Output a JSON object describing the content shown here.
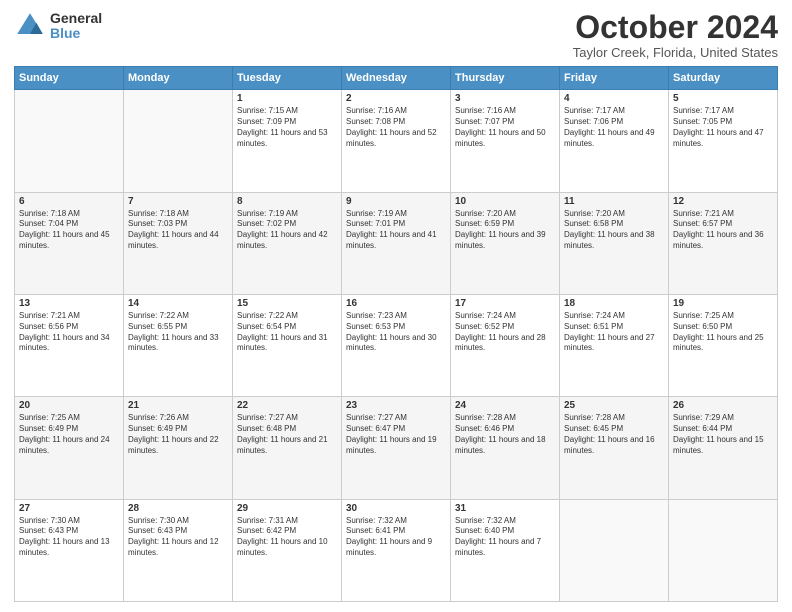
{
  "logo": {
    "general": "General",
    "blue": "Blue"
  },
  "header": {
    "title": "October 2024",
    "location": "Taylor Creek, Florida, United States"
  },
  "weekdays": [
    "Sunday",
    "Monday",
    "Tuesday",
    "Wednesday",
    "Thursday",
    "Friday",
    "Saturday"
  ],
  "weeks": [
    [
      {
        "day": "",
        "sunrise": "",
        "sunset": "",
        "daylight": ""
      },
      {
        "day": "",
        "sunrise": "",
        "sunset": "",
        "daylight": ""
      },
      {
        "day": "1",
        "sunrise": "Sunrise: 7:15 AM",
        "sunset": "Sunset: 7:09 PM",
        "daylight": "Daylight: 11 hours and 53 minutes."
      },
      {
        "day": "2",
        "sunrise": "Sunrise: 7:16 AM",
        "sunset": "Sunset: 7:08 PM",
        "daylight": "Daylight: 11 hours and 52 minutes."
      },
      {
        "day": "3",
        "sunrise": "Sunrise: 7:16 AM",
        "sunset": "Sunset: 7:07 PM",
        "daylight": "Daylight: 11 hours and 50 minutes."
      },
      {
        "day": "4",
        "sunrise": "Sunrise: 7:17 AM",
        "sunset": "Sunset: 7:06 PM",
        "daylight": "Daylight: 11 hours and 49 minutes."
      },
      {
        "day": "5",
        "sunrise": "Sunrise: 7:17 AM",
        "sunset": "Sunset: 7:05 PM",
        "daylight": "Daylight: 11 hours and 47 minutes."
      }
    ],
    [
      {
        "day": "6",
        "sunrise": "Sunrise: 7:18 AM",
        "sunset": "Sunset: 7:04 PM",
        "daylight": "Daylight: 11 hours and 45 minutes."
      },
      {
        "day": "7",
        "sunrise": "Sunrise: 7:18 AM",
        "sunset": "Sunset: 7:03 PM",
        "daylight": "Daylight: 11 hours and 44 minutes."
      },
      {
        "day": "8",
        "sunrise": "Sunrise: 7:19 AM",
        "sunset": "Sunset: 7:02 PM",
        "daylight": "Daylight: 11 hours and 42 minutes."
      },
      {
        "day": "9",
        "sunrise": "Sunrise: 7:19 AM",
        "sunset": "Sunset: 7:01 PM",
        "daylight": "Daylight: 11 hours and 41 minutes."
      },
      {
        "day": "10",
        "sunrise": "Sunrise: 7:20 AM",
        "sunset": "Sunset: 6:59 PM",
        "daylight": "Daylight: 11 hours and 39 minutes."
      },
      {
        "day": "11",
        "sunrise": "Sunrise: 7:20 AM",
        "sunset": "Sunset: 6:58 PM",
        "daylight": "Daylight: 11 hours and 38 minutes."
      },
      {
        "day": "12",
        "sunrise": "Sunrise: 7:21 AM",
        "sunset": "Sunset: 6:57 PM",
        "daylight": "Daylight: 11 hours and 36 minutes."
      }
    ],
    [
      {
        "day": "13",
        "sunrise": "Sunrise: 7:21 AM",
        "sunset": "Sunset: 6:56 PM",
        "daylight": "Daylight: 11 hours and 34 minutes."
      },
      {
        "day": "14",
        "sunrise": "Sunrise: 7:22 AM",
        "sunset": "Sunset: 6:55 PM",
        "daylight": "Daylight: 11 hours and 33 minutes."
      },
      {
        "day": "15",
        "sunrise": "Sunrise: 7:22 AM",
        "sunset": "Sunset: 6:54 PM",
        "daylight": "Daylight: 11 hours and 31 minutes."
      },
      {
        "day": "16",
        "sunrise": "Sunrise: 7:23 AM",
        "sunset": "Sunset: 6:53 PM",
        "daylight": "Daylight: 11 hours and 30 minutes."
      },
      {
        "day": "17",
        "sunrise": "Sunrise: 7:24 AM",
        "sunset": "Sunset: 6:52 PM",
        "daylight": "Daylight: 11 hours and 28 minutes."
      },
      {
        "day": "18",
        "sunrise": "Sunrise: 7:24 AM",
        "sunset": "Sunset: 6:51 PM",
        "daylight": "Daylight: 11 hours and 27 minutes."
      },
      {
        "day": "19",
        "sunrise": "Sunrise: 7:25 AM",
        "sunset": "Sunset: 6:50 PM",
        "daylight": "Daylight: 11 hours and 25 minutes."
      }
    ],
    [
      {
        "day": "20",
        "sunrise": "Sunrise: 7:25 AM",
        "sunset": "Sunset: 6:49 PM",
        "daylight": "Daylight: 11 hours and 24 minutes."
      },
      {
        "day": "21",
        "sunrise": "Sunrise: 7:26 AM",
        "sunset": "Sunset: 6:49 PM",
        "daylight": "Daylight: 11 hours and 22 minutes."
      },
      {
        "day": "22",
        "sunrise": "Sunrise: 7:27 AM",
        "sunset": "Sunset: 6:48 PM",
        "daylight": "Daylight: 11 hours and 21 minutes."
      },
      {
        "day": "23",
        "sunrise": "Sunrise: 7:27 AM",
        "sunset": "Sunset: 6:47 PM",
        "daylight": "Daylight: 11 hours and 19 minutes."
      },
      {
        "day": "24",
        "sunrise": "Sunrise: 7:28 AM",
        "sunset": "Sunset: 6:46 PM",
        "daylight": "Daylight: 11 hours and 18 minutes."
      },
      {
        "day": "25",
        "sunrise": "Sunrise: 7:28 AM",
        "sunset": "Sunset: 6:45 PM",
        "daylight": "Daylight: 11 hours and 16 minutes."
      },
      {
        "day": "26",
        "sunrise": "Sunrise: 7:29 AM",
        "sunset": "Sunset: 6:44 PM",
        "daylight": "Daylight: 11 hours and 15 minutes."
      }
    ],
    [
      {
        "day": "27",
        "sunrise": "Sunrise: 7:30 AM",
        "sunset": "Sunset: 6:43 PM",
        "daylight": "Daylight: 11 hours and 13 minutes."
      },
      {
        "day": "28",
        "sunrise": "Sunrise: 7:30 AM",
        "sunset": "Sunset: 6:43 PM",
        "daylight": "Daylight: 11 hours and 12 minutes."
      },
      {
        "day": "29",
        "sunrise": "Sunrise: 7:31 AM",
        "sunset": "Sunset: 6:42 PM",
        "daylight": "Daylight: 11 hours and 10 minutes."
      },
      {
        "day": "30",
        "sunrise": "Sunrise: 7:32 AM",
        "sunset": "Sunset: 6:41 PM",
        "daylight": "Daylight: 11 hours and 9 minutes."
      },
      {
        "day": "31",
        "sunrise": "Sunrise: 7:32 AM",
        "sunset": "Sunset: 6:40 PM",
        "daylight": "Daylight: 11 hours and 7 minutes."
      },
      {
        "day": "",
        "sunrise": "",
        "sunset": "",
        "daylight": ""
      },
      {
        "day": "",
        "sunrise": "",
        "sunset": "",
        "daylight": ""
      }
    ]
  ]
}
